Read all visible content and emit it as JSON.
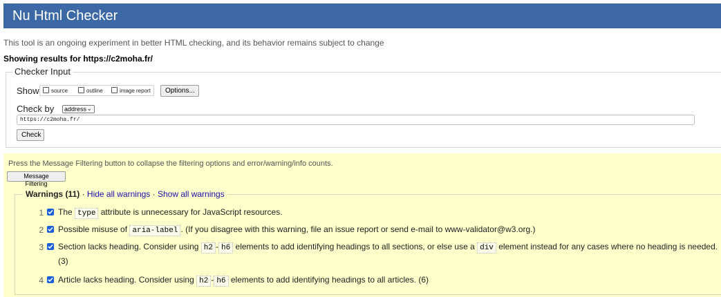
{
  "header": {
    "title": "Nu Html Checker"
  },
  "intro": "This tool is an ongoing experiment in better HTML checking, and its behavior remains subject to change",
  "showing": "Showing results for https://c2moha.fr/",
  "checker_input": {
    "legend": "Checker Input",
    "show_label": "Show",
    "options": [
      {
        "label": "source",
        "checked": false
      },
      {
        "label": "outline",
        "checked": false
      },
      {
        "label": "image report",
        "checked": false
      }
    ],
    "options_button": "Options...",
    "check_by_label": "Check by",
    "check_by_value": "address",
    "address_value": "https://c2moha.fr/",
    "check_button": "Check"
  },
  "filtering": {
    "instructions": "Press the Message Filtering button to collapse the filtering options and error/warning/info counts.",
    "button": "Message Filtering"
  },
  "warnings": {
    "title": "Warnings (11)",
    "separator": "·",
    "hide_all": "Hide all warnings",
    "show_all": "Show all warnings",
    "items": [
      {
        "num": "1",
        "parts": [
          "The ",
          "type",
          " attribute is unnecessary for JavaScript resources."
        ]
      },
      {
        "num": "2",
        "parts": [
          "Possible misuse of ",
          "aria-label",
          ". (If you disagree with this warning, file an issue report or send e-mail to www-validator@w3.org.)"
        ]
      },
      {
        "num": "3",
        "parts": [
          "Section lacks heading. Consider using ",
          "h2",
          "-",
          "h6",
          " elements to add identifying headings to all sections, or else use a ",
          "div",
          " element instead for any cases where no heading is needed."
        ],
        "cont": "(3)"
      },
      {
        "num": "4",
        "parts": [
          "Article lacks heading. Consider using ",
          "h2",
          "-",
          "h6",
          " elements to add identifying headings to all articles. (6)"
        ]
      }
    ]
  }
}
